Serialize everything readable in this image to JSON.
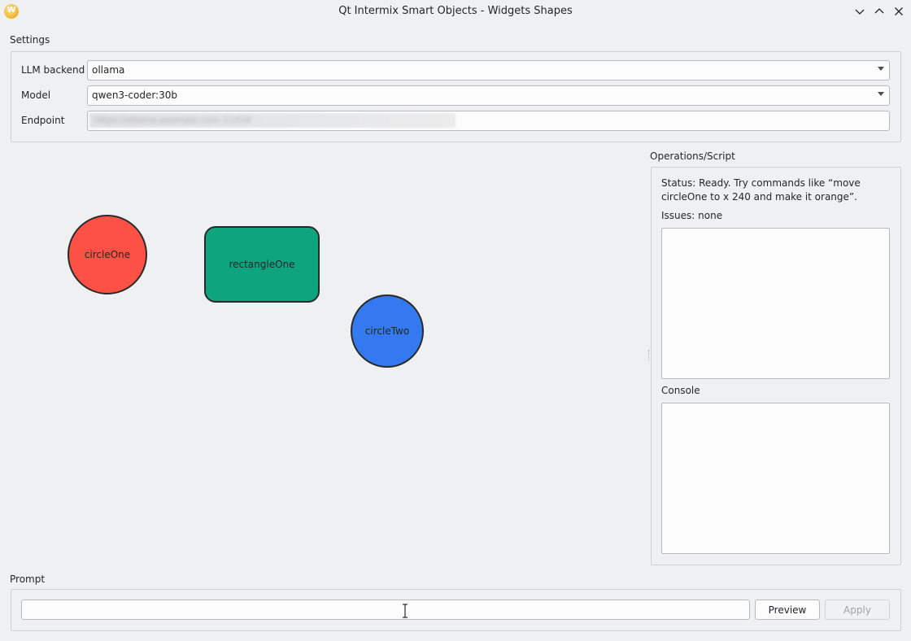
{
  "window": {
    "title": "Qt Intermix Smart Objects - Widgets Shapes",
    "app_icon_letter": "W"
  },
  "settings": {
    "group_label": "Settings",
    "llm_backend_label": "LLM backend",
    "llm_backend_value": "ollama",
    "model_label": "Model",
    "model_value": "qwen3-coder:30b",
    "endpoint_label": "Endpoint",
    "endpoint_value": "https://ollama.example.com:11434"
  },
  "canvas": {
    "shapes": [
      {
        "name": "circleOne",
        "label": "circleOne",
        "color": "#fe5145"
      },
      {
        "name": "rectangleOne",
        "label": "rectangleOne",
        "color": "#0ea57e"
      },
      {
        "name": "circleTwo",
        "label": "circleTwo",
        "color": "#3579f0"
      }
    ]
  },
  "operations": {
    "group_label": "Operations/Script",
    "status_text": "Status: Ready. Try commands like “move circleOne to x 240 and make it orange”.",
    "issues_text": "Issues: none",
    "console_label": "Console"
  },
  "prompt": {
    "group_label": "Prompt",
    "input_value": "",
    "preview_label": "Preview",
    "apply_label": "Apply"
  },
  "colors": {
    "background": "#eff0f1",
    "border": "#b8babc"
  }
}
